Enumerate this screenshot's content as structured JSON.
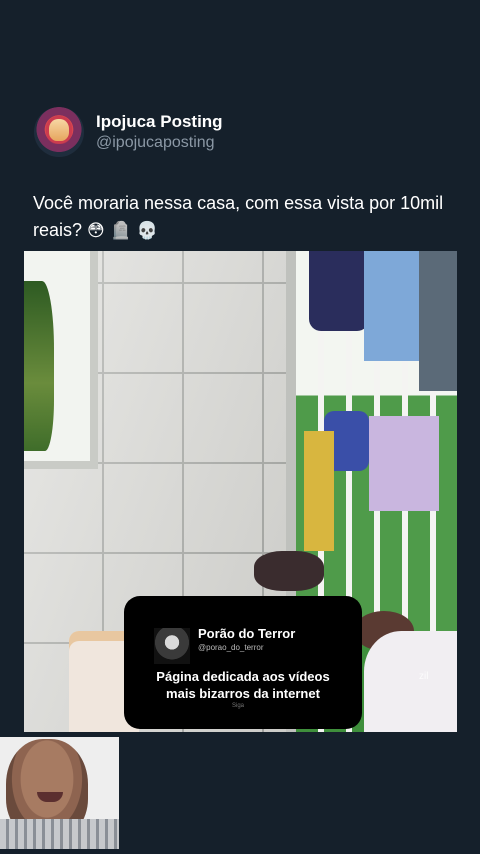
{
  "post": {
    "display_name": "Ipojuca Posting",
    "handle": "@ipojucaposting",
    "text": "Você moraria nessa casa, com essa vista por 10mil reais?",
    "emojis": "😳 🪦 💀"
  },
  "video_overlay": {
    "title": "Porão do Terror",
    "handle": "@porao_do_terror",
    "description": "Página dedicada aos vídeos mais bizarros da internet",
    "tag": "Siga",
    "watermark": "zil"
  },
  "colors": {
    "background": "#15202b",
    "handle": "#8b98a5",
    "overlay": "#000000"
  }
}
